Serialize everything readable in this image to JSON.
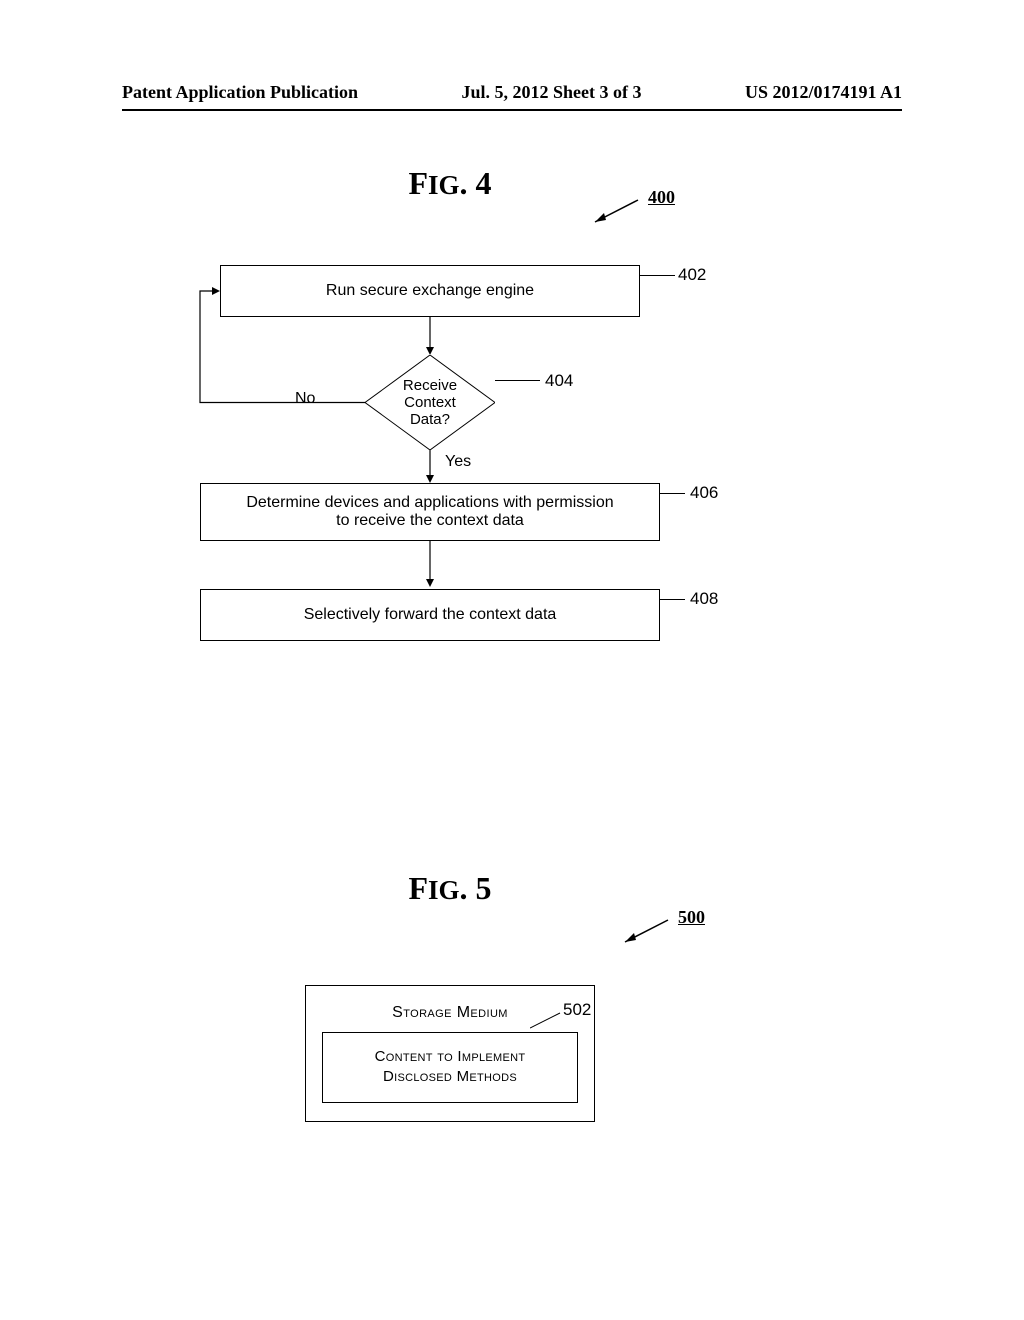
{
  "header": {
    "left": "Patent Application Publication",
    "center": "Jul. 5, 2012   Sheet 3 of 3",
    "right": "US 2012/0174191 A1"
  },
  "fig4": {
    "title_f": "F",
    "title_ig": "IG",
    "title_rest": ". 4",
    "ref_number": "400",
    "box402": "Run secure exchange engine",
    "ref402": "402",
    "diamond404": "Receive\nContext\nData?",
    "ref404": "404",
    "label_no": "No",
    "label_yes": "Yes",
    "box406": "Determine devices and applications with permission\nto receive the context data",
    "ref406": "406",
    "box408": "Selectively forward the context data",
    "ref408": "408"
  },
  "fig5": {
    "title_f": "F",
    "title_ig": "IG",
    "title_rest": ". 5",
    "ref_number": "500",
    "storage_title": "Storage Medium",
    "ref502": "502",
    "content_text": "Content to Implement\nDisclosed Methods"
  }
}
